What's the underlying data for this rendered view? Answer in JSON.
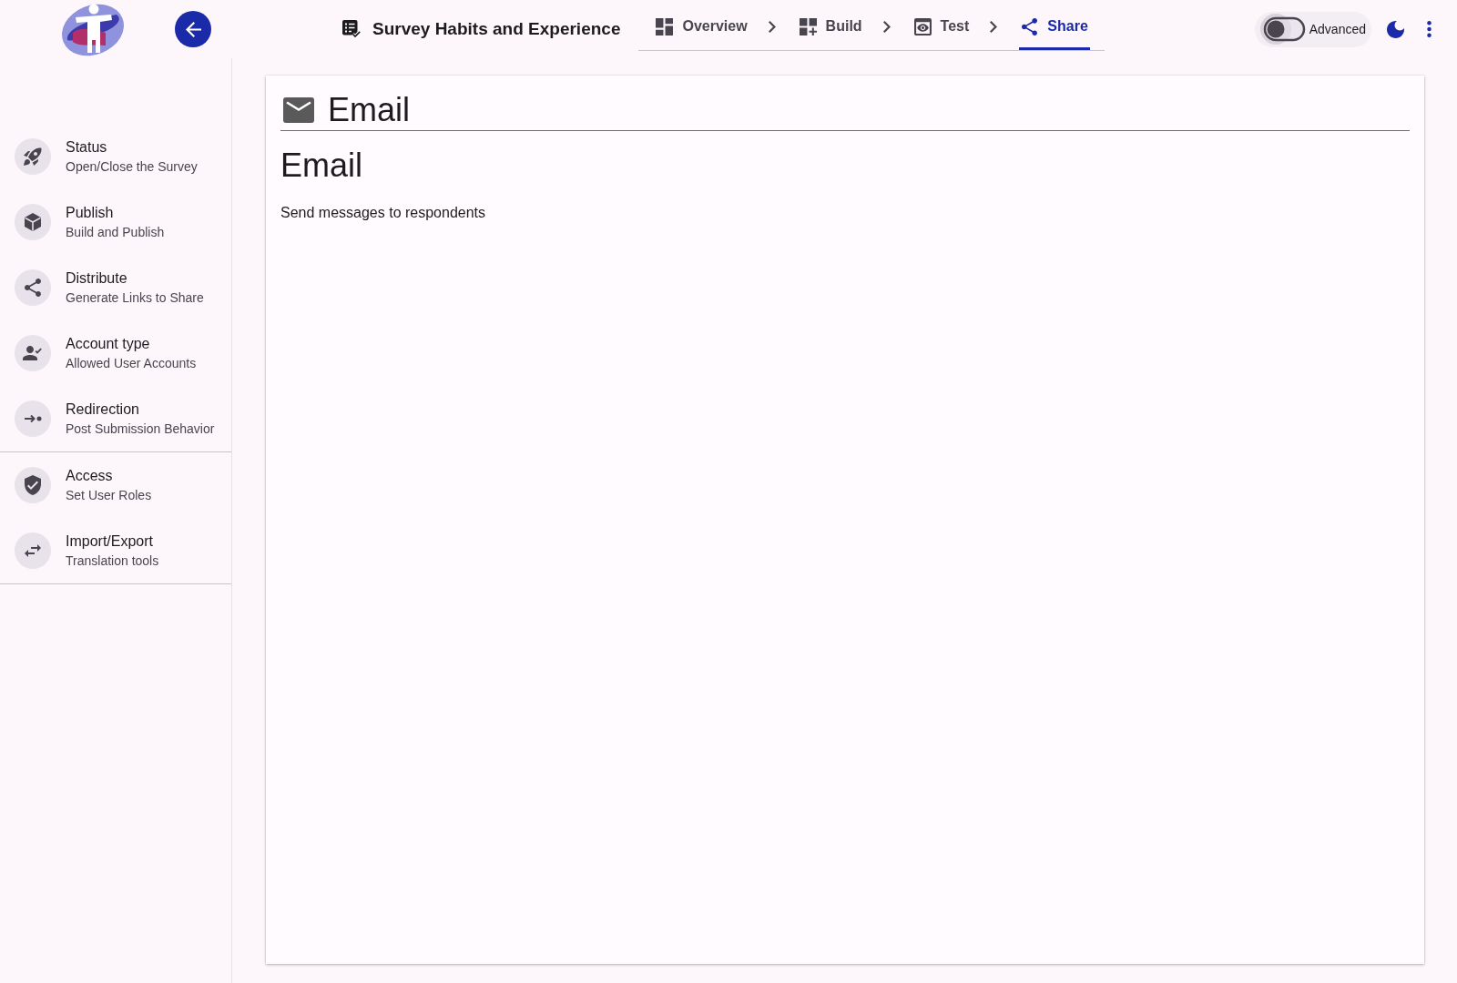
{
  "top_bar": {
    "survey_title": "Survey Habits and Experience",
    "tabs": [
      {
        "label": "Overview",
        "selected": false
      },
      {
        "label": "Build",
        "selected": false
      },
      {
        "label": "Test",
        "selected": false
      },
      {
        "label": "Share",
        "selected": true
      }
    ],
    "advanced_toggle": {
      "label": "Advanced",
      "on": false
    }
  },
  "sidebar": {
    "sections": [
      {
        "items": [
          {
            "title": "Status",
            "subtitle": "Open/Close the Survey",
            "selected": false
          },
          {
            "title": "Publish",
            "subtitle": "Build and Publish",
            "selected": false
          },
          {
            "title": "Distribute",
            "subtitle": "Generate Links to Share",
            "selected": false
          },
          {
            "title": "Account type",
            "subtitle": "Allowed User Accounts",
            "selected": false
          },
          {
            "title": "Redirection",
            "subtitle": "Post Submission Behavior",
            "selected": false
          }
        ]
      },
      {
        "items": [
          {
            "title": "Access",
            "subtitle": "Set User Roles",
            "selected": false
          },
          {
            "title": "Import/Export",
            "subtitle": "Translation tools",
            "selected": false
          }
        ]
      }
    ]
  },
  "content": {
    "card_title": "Email",
    "heading": "Email",
    "description": "Send messages to respondents"
  }
}
